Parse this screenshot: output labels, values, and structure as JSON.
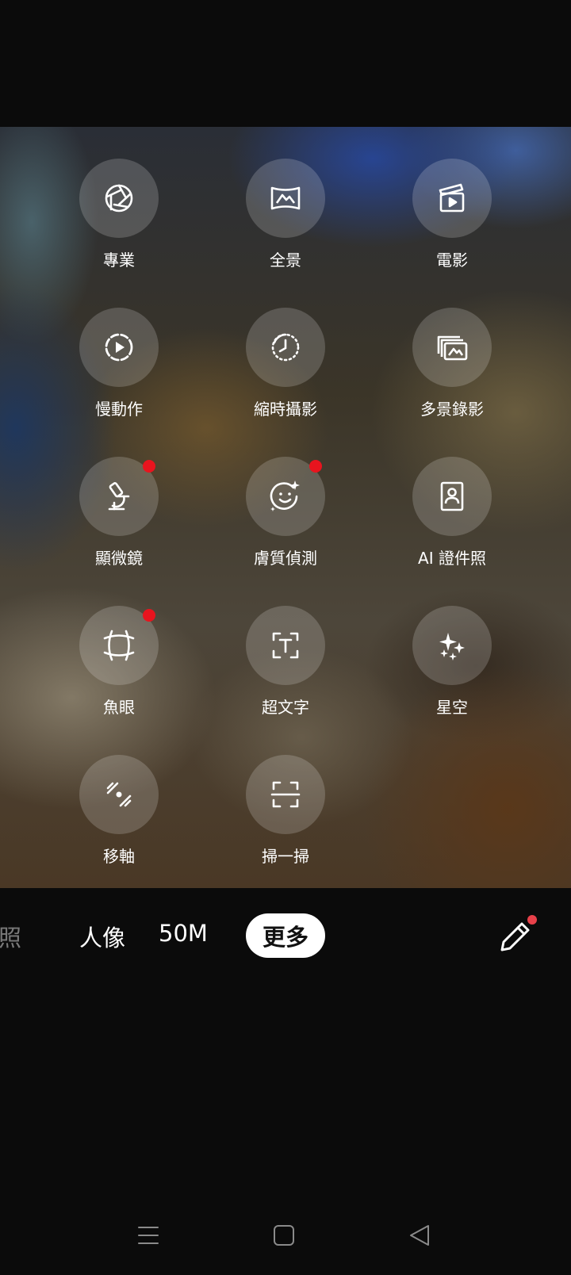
{
  "modes_grid": {
    "items": [
      {
        "label": "專業",
        "icon": "aperture-icon",
        "badge": false
      },
      {
        "label": "全景",
        "icon": "panorama-icon",
        "badge": false
      },
      {
        "label": "電影",
        "icon": "clapperboard-icon",
        "badge": false
      },
      {
        "label": "慢動作",
        "icon": "slow-motion-icon",
        "badge": false
      },
      {
        "label": "縮時攝影",
        "icon": "time-lapse-icon",
        "badge": false
      },
      {
        "label": "多景錄影",
        "icon": "multi-scene-video-icon",
        "badge": false
      },
      {
        "label": "顯微鏡",
        "icon": "microscope-icon",
        "badge": true
      },
      {
        "label": "膚質偵測",
        "icon": "face-sparkle-icon",
        "badge": true
      },
      {
        "label": "AI 證件照",
        "icon": "id-photo-icon",
        "badge": false
      },
      {
        "label": "魚眼",
        "icon": "fisheye-icon",
        "badge": true
      },
      {
        "label": "超文字",
        "icon": "text-scan-icon",
        "badge": false
      },
      {
        "label": "星空",
        "icon": "starry-sky-icon",
        "badge": false
      },
      {
        "label": "移軸",
        "icon": "tilt-shift-icon",
        "badge": false
      },
      {
        "label": "掃一掃",
        "icon": "scan-icon",
        "badge": false
      }
    ]
  },
  "mode_bar": {
    "partial_tab": "照",
    "portrait": "人像",
    "fifty_m": "50M",
    "more": "更多",
    "edit_icon": "pencil-icon"
  },
  "nav": {
    "menu_icon": "menu-icon",
    "home_icon": "home-icon",
    "back_icon": "back-icon"
  },
  "colors": {
    "badge": "#e8141e",
    "pill_bg": "#ffffff",
    "background": "#0b0b0b"
  }
}
